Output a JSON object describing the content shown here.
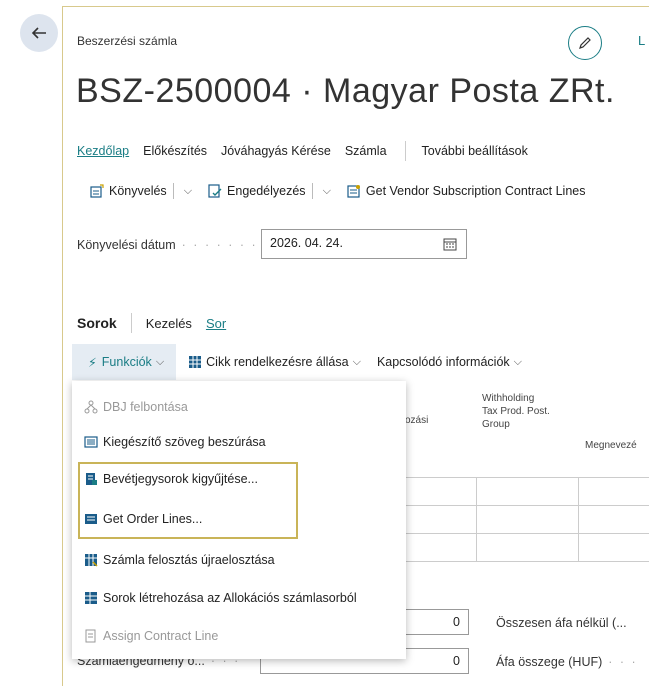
{
  "header": {
    "breadcrumb": "Beszerzési számla",
    "title": "BSZ-2500004 · Magyar Posta ZRt.",
    "edit_partial": "L"
  },
  "tabs": [
    {
      "label": "Kezdőlap",
      "active": true
    },
    {
      "label": "Előkészítés",
      "active": false
    },
    {
      "label": "Jóváhagyás Kérése",
      "active": false
    },
    {
      "label": "Számla",
      "active": false
    },
    {
      "label": "További beállítások",
      "active": false
    }
  ],
  "actions": {
    "post": "Könyvelés",
    "approve": "Engedélyezés",
    "get_vendor": "Get Vendor Subscription Contract Lines"
  },
  "posting_date": {
    "label": "Könyvelési dátum",
    "value": "2026. 04. 24."
  },
  "lines": {
    "title": "Sorok",
    "tabs": [
      "Kezelés",
      "Sor"
    ],
    "functions": "Funkciók",
    "item_availability": "Cikk rendelkezésre állása",
    "related_info": "Kapcsolódó információk"
  },
  "grid_headers": {
    "col_a_line1": "kozási",
    "col_a_line2": "a",
    "col_b_line1": "Withholding",
    "col_b_line2": "Tax Prod. Post.",
    "col_b_line3": "Group",
    "col_c": "Megnevezé"
  },
  "menu": [
    {
      "label": "DBJ felbontása",
      "icon": "split-icon",
      "disabled": true
    },
    {
      "label": "Kiegészítő szöveg beszúrása",
      "icon": "text-list-icon",
      "disabled": false
    },
    {
      "label": "Bevétjegysorok kigyűjtése...",
      "icon": "receipt-lines-icon",
      "disabled": false
    },
    {
      "label": "Get Order Lines...",
      "icon": "order-lines-icon",
      "disabled": false
    },
    {
      "label": "Számla felosztás újraelosztása",
      "icon": "redistribute-icon",
      "disabled": false
    },
    {
      "label": "Sorok létrehozása az Allokációs számlasorból",
      "icon": "create-lines-icon",
      "disabled": false
    },
    {
      "label": "Assign Contract Line",
      "icon": "assign-contract-icon",
      "disabled": true
    }
  ],
  "totals": {
    "value1": "0",
    "value2": "0",
    "discount_label": "Számlaengedmény ö...",
    "total_excl_vat_label": "Összesen áfa nélkül (...",
    "vat_amount_label": "Áfa összege (HUF)"
  },
  "colors": {
    "accent": "#1a7d85",
    "highlight_border": "#c9b458",
    "button_bg": "#e5ecf3"
  }
}
